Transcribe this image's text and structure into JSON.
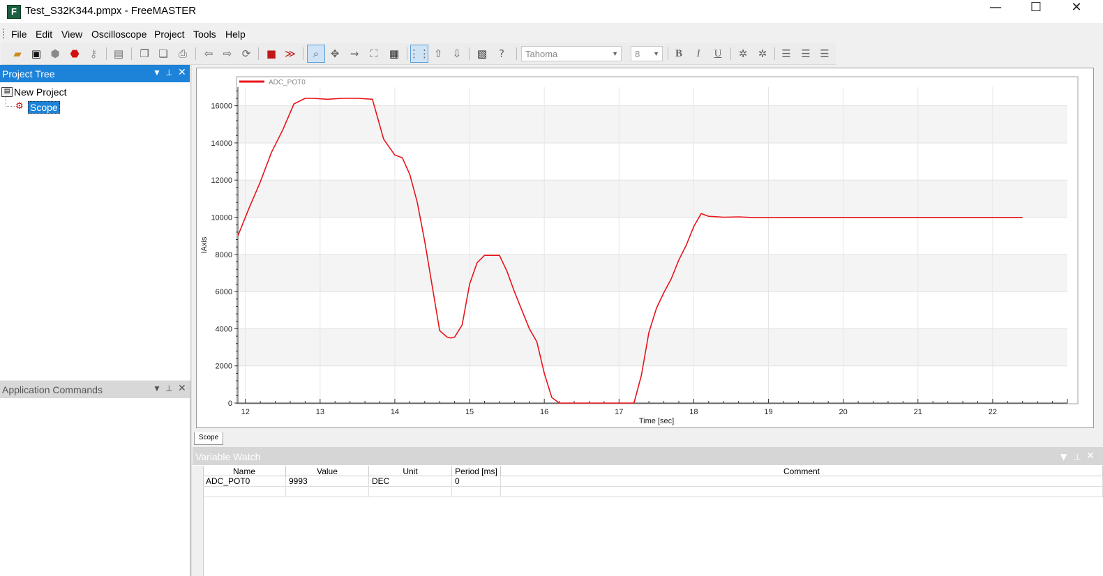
{
  "window": {
    "title": "Test_S32K344.pmpx - FreeMASTER",
    "app_icon_letter": "F",
    "controls": {
      "minimize": "—",
      "maximize": "☐",
      "close": "✕"
    }
  },
  "menu": [
    "File",
    "Edit",
    "View",
    "Oscilloscope",
    "Project",
    "Tools",
    "Help"
  ],
  "toolbar": {
    "font_name": "Tahoma",
    "font_size": "8",
    "icons": [
      "open-folder",
      "save",
      "go",
      "stop",
      "key",
      "layout",
      "copy",
      "paste",
      "print",
      "back",
      "forward",
      "refresh",
      "stop-recorder",
      "scope-run",
      "zoom-in",
      "zoom-out",
      "zoom-arrow",
      "zoom-fit",
      "save-data",
      "grid",
      "arrow-up",
      "arrow-down",
      "properties",
      "help",
      "bold",
      "italic",
      "underline",
      "font-color",
      "back-color",
      "align-left",
      "align-center",
      "align-right"
    ]
  },
  "project_tree": {
    "title": "Project Tree",
    "items": [
      "New Project",
      "Scope"
    ]
  },
  "app_commands": {
    "title": "Application Commands"
  },
  "scope": {
    "tab_label": "Scope"
  },
  "chart_data": {
    "type": "line",
    "title": "",
    "xlabel": "Time [sec]",
    "ylabel": "IAxis",
    "xlim": [
      11.9,
      23.0
    ],
    "ylim": [
      0,
      17000
    ],
    "x_ticks": [
      12,
      13,
      14,
      15,
      16,
      17,
      18,
      19,
      20,
      21,
      22
    ],
    "y_ticks": [
      0,
      2000,
      4000,
      6000,
      8000,
      10000,
      12000,
      14000,
      16000
    ],
    "grid": true,
    "legend": "top-left",
    "series": [
      {
        "name": "ADC_POT0",
        "color": "#e8141a",
        "x": [
          11.9,
          12.05,
          12.2,
          12.35,
          12.5,
          12.65,
          12.8,
          12.9,
          13.1,
          13.3,
          13.5,
          13.7,
          13.85,
          14.0,
          14.1,
          14.2,
          14.3,
          14.4,
          14.5,
          14.6,
          14.7,
          14.75,
          14.8,
          14.9,
          15.0,
          15.1,
          15.2,
          15.3,
          15.4,
          15.5,
          15.6,
          15.7,
          15.8,
          15.9,
          16.0,
          16.1,
          16.2,
          16.3,
          16.4,
          16.6,
          16.8,
          17.0,
          17.2,
          17.3,
          17.4,
          17.5,
          17.6,
          17.7,
          17.8,
          17.9,
          18.0,
          18.1,
          18.2,
          18.4,
          18.6,
          18.8,
          19.5,
          20.5,
          21.5,
          22.4
        ],
        "y": [
          9000,
          10500,
          11900,
          13500,
          14700,
          16100,
          16400,
          16400,
          16350,
          16400,
          16400,
          16350,
          14200,
          13350,
          13200,
          12300,
          10800,
          8700,
          6300,
          3900,
          3550,
          3500,
          3550,
          4200,
          6400,
          7550,
          7950,
          7950,
          7950,
          7100,
          6000,
          5000,
          4000,
          3300,
          1600,
          300,
          0,
          0,
          0,
          0,
          0,
          0,
          0,
          1500,
          3800,
          5100,
          5950,
          6700,
          7700,
          8500,
          9500,
          10200,
          10050,
          10000,
          10020,
          9980,
          9990,
          9990,
          9990,
          9990
        ]
      }
    ]
  },
  "watch": {
    "title": "Variable Watch",
    "columns": [
      "Name",
      "Value",
      "Unit",
      "Period [ms]",
      "Comment"
    ],
    "rows": [
      [
        "ADC_POT0",
        "9993",
        "DEC",
        "0",
        ""
      ],
      [
        "",
        "",
        "",
        "",
        ""
      ]
    ]
  }
}
